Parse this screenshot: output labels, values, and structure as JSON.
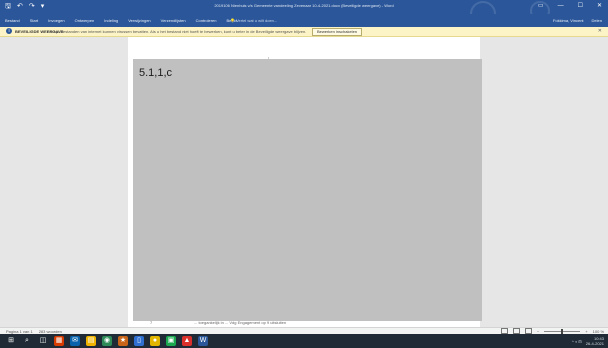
{
  "window": {
    "title": "2019106 Nienhuis v/s Gemeente vandeeling Zevenaar 10-4-2021.docx (Beveiligde weergave) - Word",
    "qat": [
      "🖫",
      "↶",
      "↷",
      "▾"
    ],
    "controls": [
      "▭",
      "—",
      "☐",
      "✕"
    ]
  },
  "ribbon": {
    "tabs": [
      "Bestand",
      "Start",
      "Invoegen",
      "Ontwerpen",
      "Indeling",
      "Verwijzingen",
      "Verzendlijsten",
      "Controleren",
      "Beeld"
    ],
    "search_hint": "💡 Vertel wat u wilt doen...",
    "account": "Fokkima, Vincent",
    "share": "Delen"
  },
  "protected_view": {
    "title": "BEVEILIGDE WEERGAVE",
    "message": "Let op: Bestanden van internet kunnen virussen bevatten. Als u het bestand niet hoeft te bewerken, kunt u beter in de Beveiligde weergave blijven.",
    "button": "Bewerken inschakelen",
    "close": "✕"
  },
  "document": {
    "block_label": "5.1,1,c",
    "footer_text": "... toegankelijk in ... Vdg Engagement op 9 uitsluiten",
    "left_mark": "7"
  },
  "status": {
    "page": "Pagina 1 van 1",
    "words": "283 woorden",
    "zoom": "100 %"
  },
  "taskbar": {
    "icons": [
      "⊞",
      "⌕",
      "◫",
      "▦",
      "✉",
      "▤",
      "◉",
      "★",
      "▯",
      "●",
      "▣",
      "▲",
      "W"
    ],
    "time": "10:43",
    "date": "26-4-2021",
    "tray": "^ ◖ ⊟"
  },
  "colors": {
    "ribbon": "#2b579a",
    "protected_bar": "#fcf4c6",
    "gray_block": "#c0c0c0",
    "taskbar": "#1f2a36"
  }
}
